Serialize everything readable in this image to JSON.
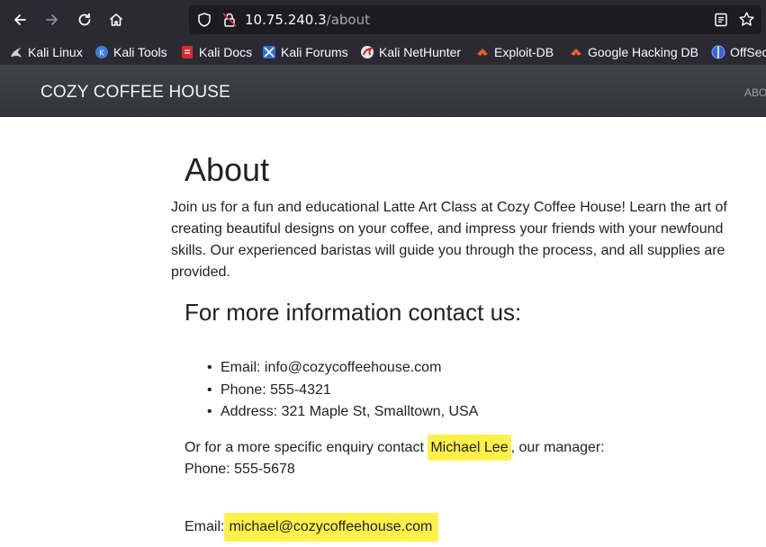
{
  "browser": {
    "url_host": "10.75.240.3",
    "url_path": "/about",
    "icons": [
      "back-arrow-icon",
      "forward-arrow-icon",
      "reload-icon",
      "home-icon",
      "shield-icon",
      "insecure-lock-icon",
      "reader-view-icon",
      "bookmark-star-icon"
    ]
  },
  "bookmarks": [
    {
      "label": "Kali Linux",
      "icon": "kali-dragon-icon"
    },
    {
      "label": "Kali Tools",
      "icon": "kali-tools-icon"
    },
    {
      "label": "Kali Docs",
      "icon": "kali-docs-icon"
    },
    {
      "label": "Kali Forums",
      "icon": "kali-forums-icon"
    },
    {
      "label": "Kali NetHunter",
      "icon": "nethunter-icon"
    },
    {
      "label": "Exploit-DB",
      "icon": "exploit-db-icon"
    },
    {
      "label": "Google Hacking DB",
      "icon": "ghdb-icon"
    },
    {
      "label": "OffSec",
      "icon": "offsec-icon"
    }
  ],
  "site": {
    "brand": "COZY COFFEE HOUSE",
    "nav_about": "ABO"
  },
  "content": {
    "heading": "About",
    "intro": "Join us for a fun and educational Latte Art Class at Cozy Coffee House! Learn the art of creating beautiful designs on your coffee, and impress your friends with your newfound skills. Our experienced baristas will guide you through the process, and all supplies are provided.",
    "contact_heading": "For more information contact us:",
    "contact_items": [
      "Email: info@cozycoffeehouse.com",
      "Phone: 555-4321",
      "Address: 321 Maple St, Smalltown, USA"
    ],
    "enquiry_prefix": "Or for a more specific enquiry contact ",
    "manager_name": "Michael Lee",
    "enquiry_suffix": ", our manager:",
    "manager_phone": "Phone: 555-5678",
    "email_label": "Email:",
    "manager_email": "michael@cozycoffeehouse.com"
  },
  "colors": {
    "toolbar_bg": "#2b2a33",
    "navbar_bg": "#3a3f44",
    "highlight": "#fff14a"
  }
}
